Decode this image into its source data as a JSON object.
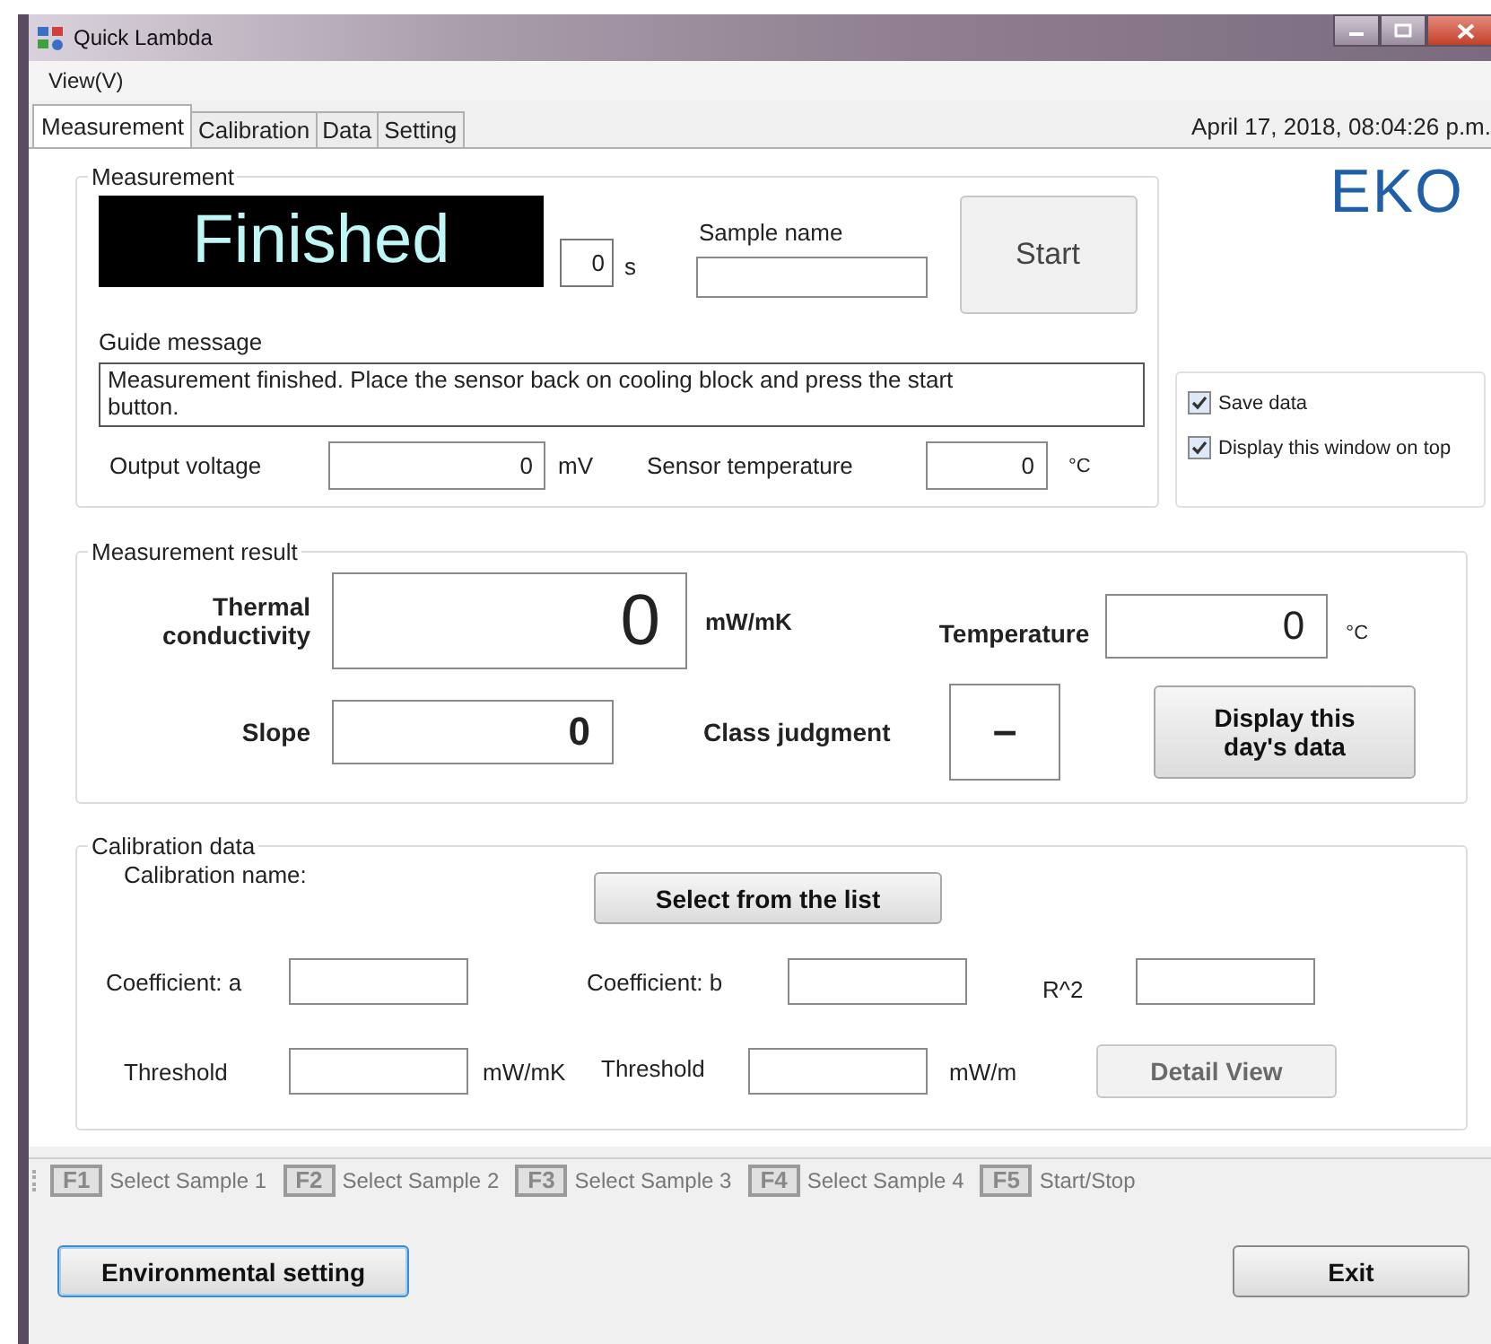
{
  "window": {
    "title": "Quick Lambda"
  },
  "menu": [
    {
      "label": "View(V)"
    }
  ],
  "tabs": [
    {
      "label": "Measurement",
      "selected": true
    },
    {
      "label": "Calibration",
      "selected": false
    },
    {
      "label": "Data",
      "selected": false
    },
    {
      "label": "Setting",
      "selected": false
    }
  ],
  "datetime": "April 17, 2018, 08:04:26 p.m.",
  "logo": "EKO",
  "measurement": {
    "title": "Measurement",
    "status": "Finished",
    "elapsed": "0",
    "elapsed_unit": "s",
    "sample_name_label": "Sample name",
    "start_button": "Start",
    "guide_label": "Guide message",
    "guide_message": "Measurement finished. Place the sensor back on cooling block and press the start button.",
    "output_voltage": {
      "label": "Output voltage",
      "value": "0",
      "unit": "mV"
    },
    "sensor_temperature": {
      "label": "Sensor temperature",
      "value": "0",
      "unit": "°C"
    }
  },
  "options": [
    {
      "label": "Save data",
      "checked": true
    },
    {
      "label": "Display this window on top",
      "checked": true
    }
  ],
  "result": {
    "title": "Measurement result",
    "thermal_conductivity": {
      "label": "Thermal conductivity",
      "value": "0",
      "unit": "mW/mK"
    },
    "temperature": {
      "label": "Temperature",
      "value": "0",
      "unit": "°C"
    },
    "slope": {
      "label": "Slope",
      "value": "0"
    },
    "class_judgment": {
      "label": "Class judgment",
      "value": "–"
    },
    "day_data_button": "Display this day's data"
  },
  "calibration": {
    "title": "Calibration data",
    "name_label": "Calibration name:",
    "select_button": "Select from the list",
    "coefficient_a": "Coefficient: a",
    "coefficient_b": "Coefficient: b",
    "r_squared": "R^2",
    "threshold_1": {
      "label": "Threshold",
      "unit": "mW/mK"
    },
    "threshold_2": {
      "label": "Threshold",
      "unit": "mW/m"
    },
    "detail_button": {
      "label": "Detail View",
      "disabled": true
    }
  },
  "shortcuts": [
    {
      "key": "F1",
      "label": "Select Sample 1"
    },
    {
      "key": "F2",
      "label": "Select Sample 2"
    },
    {
      "key": "F3",
      "label": "Select Sample 3"
    },
    {
      "key": "F4",
      "label": "Select Sample 4"
    },
    {
      "key": "F5",
      "label": "Start/Stop"
    }
  ],
  "footer_buttons": [
    {
      "label": "Environmental setting",
      "focused": true
    },
    {
      "label": "Exit",
      "focused": false
    }
  ]
}
